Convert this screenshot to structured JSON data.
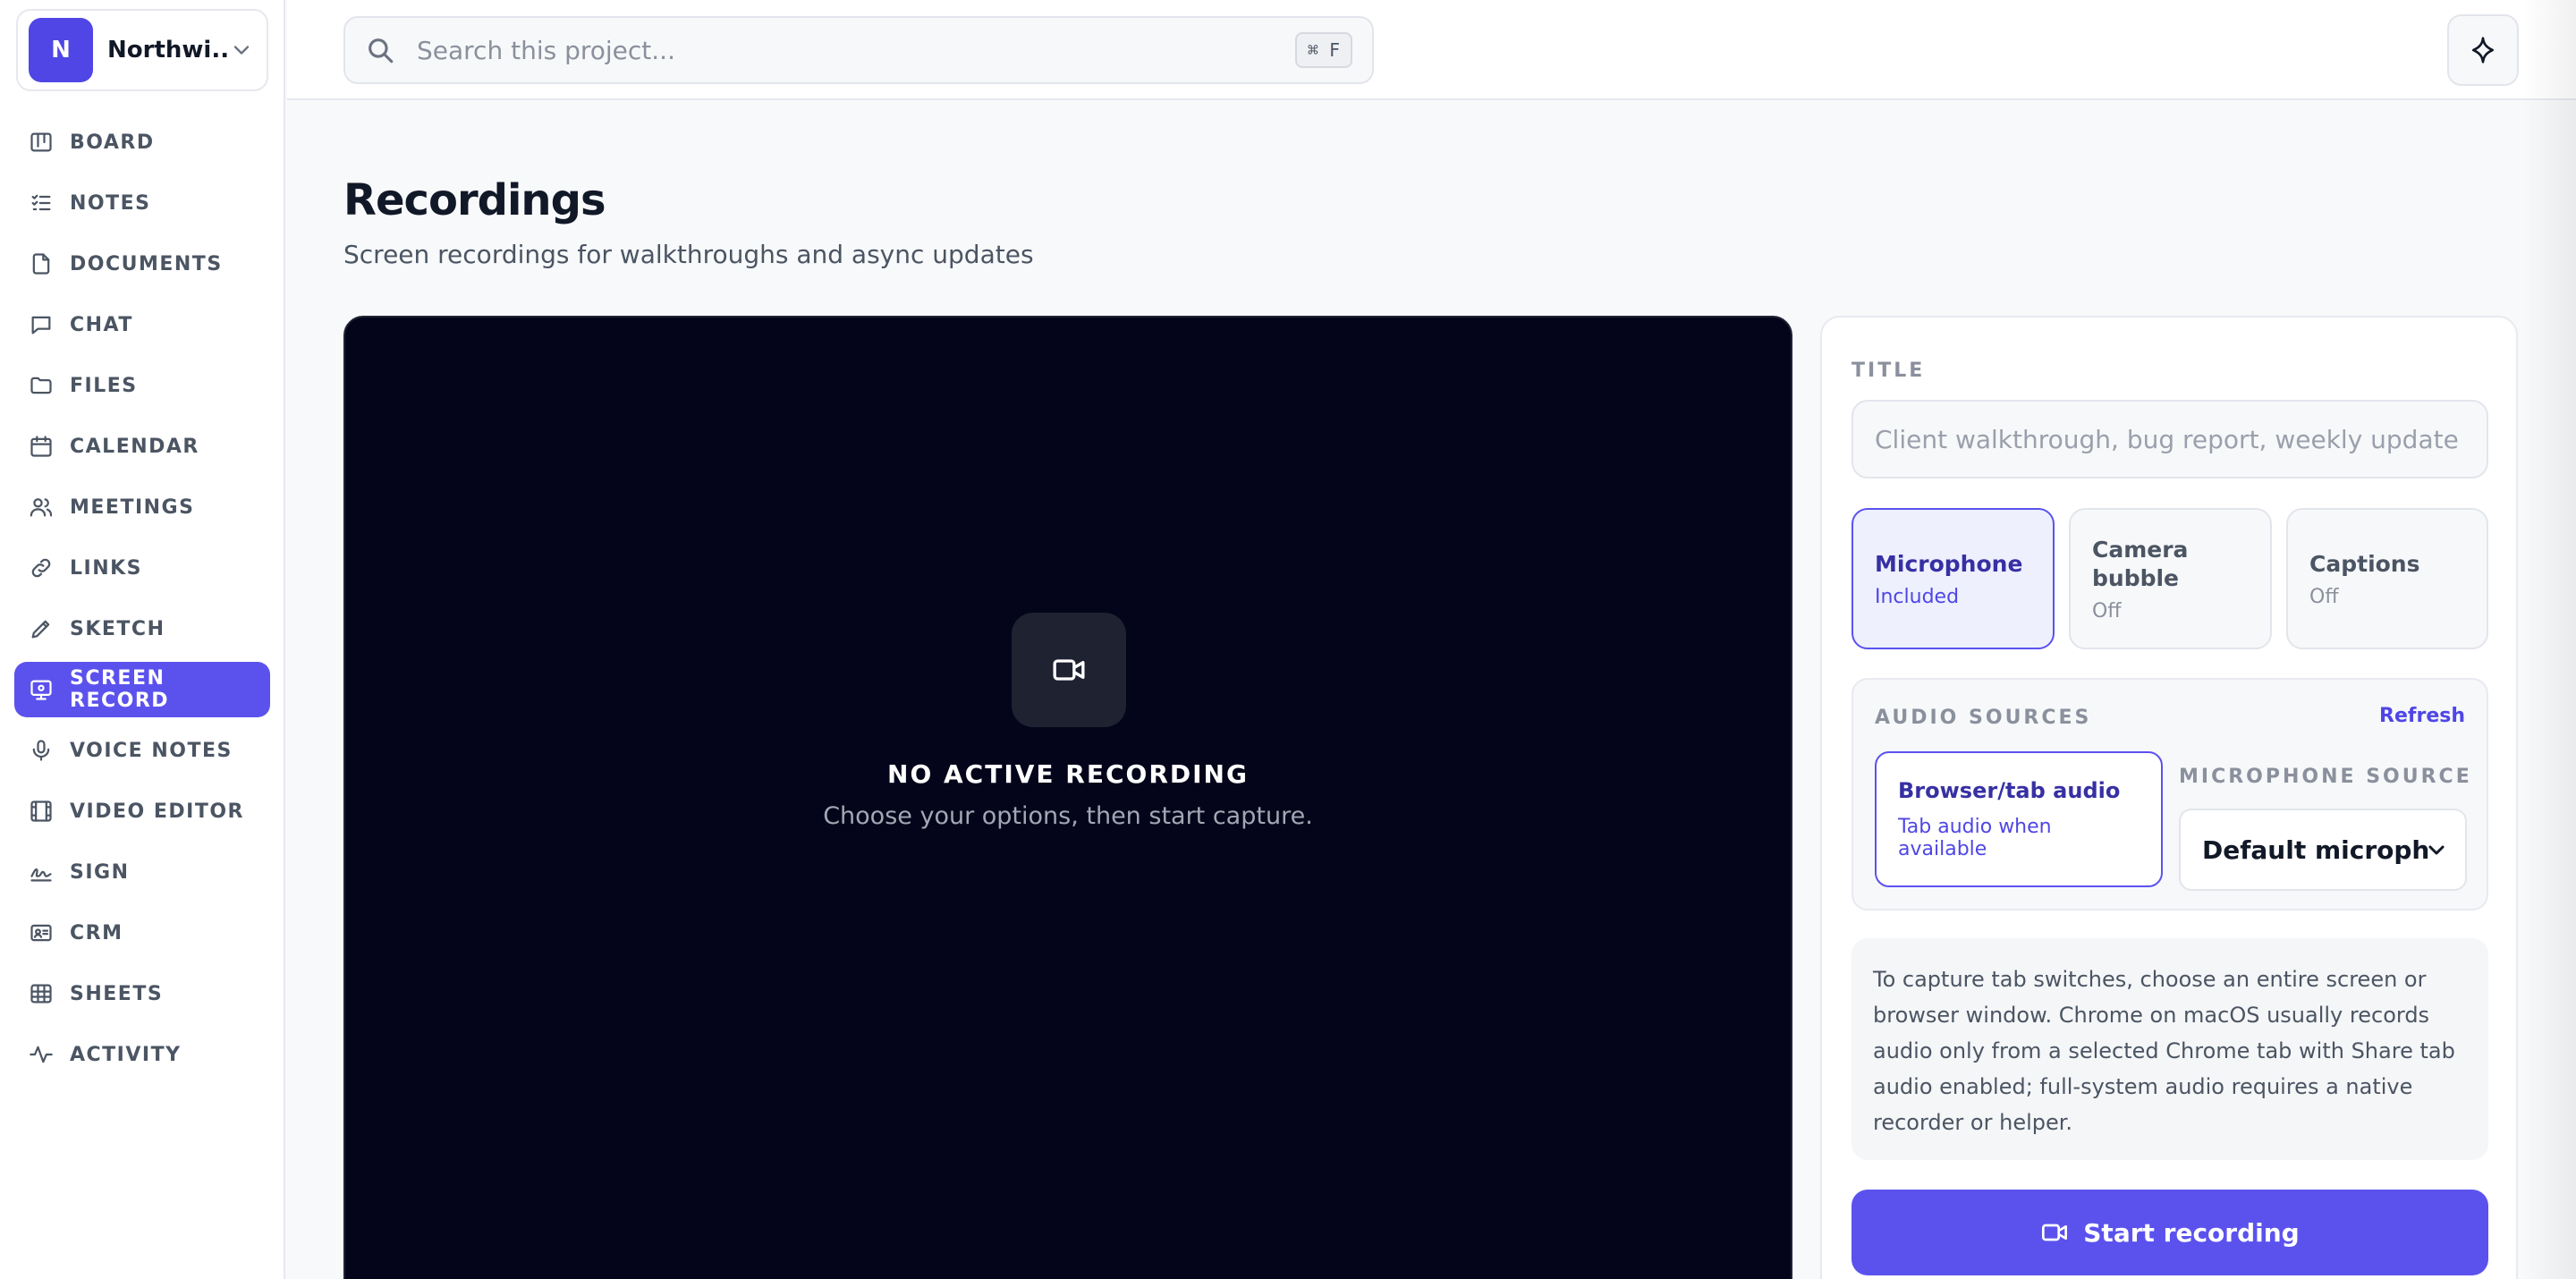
{
  "workspace": {
    "initial": "N",
    "name": "Northwi..."
  },
  "sidebar": {
    "items": [
      {
        "label": "BOARD",
        "icon": "board-icon"
      },
      {
        "label": "NOTES",
        "icon": "list-icon"
      },
      {
        "label": "DOCUMENTS",
        "icon": "document-icon"
      },
      {
        "label": "CHAT",
        "icon": "chat-icon"
      },
      {
        "label": "FILES",
        "icon": "folder-icon"
      },
      {
        "label": "CALENDAR",
        "icon": "calendar-icon"
      },
      {
        "label": "MEETINGS",
        "icon": "users-icon"
      },
      {
        "label": "LINKS",
        "icon": "link-icon"
      },
      {
        "label": "SKETCH",
        "icon": "pencil-icon"
      },
      {
        "label": "SCREEN RECORD",
        "icon": "monitor-icon",
        "active": true
      },
      {
        "label": "VOICE NOTES",
        "icon": "microphone-icon"
      },
      {
        "label": "VIDEO EDITOR",
        "icon": "film-icon"
      },
      {
        "label": "SIGN",
        "icon": "signature-icon"
      },
      {
        "label": "CRM",
        "icon": "contact-card-icon"
      },
      {
        "label": "SHEETS",
        "icon": "table-icon"
      },
      {
        "label": "ACTIVITY",
        "icon": "activity-icon"
      }
    ]
  },
  "header": {
    "search_placeholder": "Search this project...",
    "search_shortcut": "⌘ F",
    "assistant_icon": "sparkle-icon"
  },
  "page": {
    "title": "Recordings",
    "subtitle": "Screen recordings for walkthroughs and async updates"
  },
  "preview": {
    "status": "NO ACTIVE RECORDING",
    "hint": "Choose your options, then start capture.",
    "icon": "video-camera-icon"
  },
  "panel": {
    "title_label": "TITLE",
    "title_placeholder": "Client walkthrough, bug report, weekly update",
    "options": [
      {
        "title": "Microphone",
        "state": "Included",
        "selected": true
      },
      {
        "title": "Camera bubble",
        "state": "Off",
        "selected": false
      },
      {
        "title": "Captions",
        "state": "Off",
        "selected": false
      }
    ],
    "audio": {
      "heading": "AUDIO SOURCES",
      "refresh": "Refresh",
      "tab_audio_title": "Browser/tab audio",
      "tab_audio_sub": "Tab audio when available",
      "mic_label": "MICROPHONE SOURCE",
      "mic_value": "Default microphone"
    },
    "note": "To capture tab switches, choose an entire screen or browser window. Chrome on macOS usually records audio only from a selected Chrome tab with Share tab audio enabled; full-system audio requires a native recorder or helper.",
    "start_label": "Start recording"
  },
  "colors": {
    "accent": "#5b52ee",
    "preview_bg": "#04051a",
    "workspace_avatar": "#4f46e5"
  }
}
